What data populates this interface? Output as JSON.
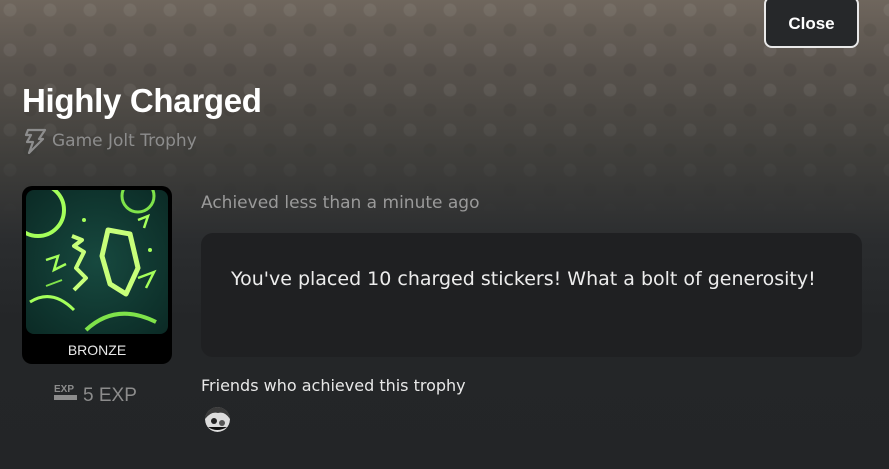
{
  "modal": {
    "close_label": "Close",
    "title": "Highly Charged",
    "trophy_type": "Game Jolt Trophy",
    "tier": "BRONZE",
    "exp": "5 EXP",
    "exp_icon_text": "EXP",
    "achieved_text": "Achieved less than a minute ago",
    "description": "You've placed 10 charged stickers! What a bolt of generosity!",
    "friends_label": "Friends who achieved this trophy"
  },
  "icons": {
    "game_jolt": "game-jolt-bolt-icon",
    "exp": "exp-icon",
    "trophy_art": "charged-10-trophy-art"
  },
  "colors": {
    "accent_green": "#a4ff5a",
    "panel": "#1f2022",
    "muted_text": "#9a9a9a"
  }
}
